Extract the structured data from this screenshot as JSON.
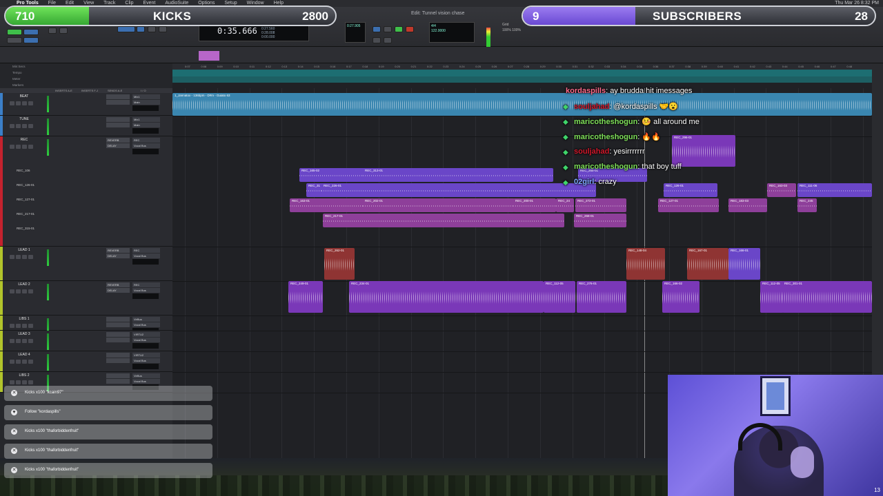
{
  "menubar": {
    "app": "Pro Tools",
    "items": [
      "File",
      "Edit",
      "View",
      "Track",
      "Clip",
      "Event",
      "AudioSuite",
      "Options",
      "Setup",
      "Window",
      "Help"
    ],
    "clock": "Thu Mar 26 8:32 PM"
  },
  "window_title": "Edit: Tunnel vision chase",
  "counter": {
    "main": "0:35.666",
    "start": "0:27.560",
    "end": "0:28.008",
    "length": "0:00.000",
    "cursor": "0:27.905",
    "nudge": "0:00.010"
  },
  "tempo": "122.0000",
  "meter_sig": "4/4",
  "grid": {
    "label": "Grid",
    "value": "100%",
    "swing": "100%"
  },
  "ruler": {
    "rows": [
      "Min:Secs",
      "Tempo",
      "Meter",
      "Markers"
    ],
    "default_label": "Default: 4/4",
    "ticks": [
      "0:07",
      "0:08",
      "0:09",
      "0:10",
      "0:11",
      "0:12",
      "0:13",
      "0:14",
      "0:15",
      "0:16",
      "0:17",
      "0:18",
      "0:19",
      "0:20",
      "0:21",
      "0:22",
      "0:23",
      "0:24",
      "0:25",
      "0:26",
      "0:27",
      "0:28",
      "0:29",
      "0:30",
      "0:31",
      "0:32",
      "0:33",
      "0:34",
      "0:35",
      "0:36",
      "0:37",
      "0:38",
      "0:39",
      "0:40",
      "0:41",
      "0:42",
      "0:43",
      "0:44",
      "0:45",
      "0:46",
      "0:47",
      "0:48"
    ]
  },
  "columns": {
    "inserts_ae": "INSERTS A-E",
    "inserts_fj": "INSERTS F-J",
    "sends_ae": "SENDS A-E",
    "io": "I / O"
  },
  "tracks": [
    {
      "name": "BEAT",
      "color": "#3b7fc8",
      "sends": [
        "",
        ""
      ],
      "io": [
        "Mix1",
        "Main"
      ]
    },
    {
      "name": "TUNE",
      "color": "#3b7fc8",
      "sends": [
        "",
        ""
      ],
      "io": [
        "Mix1",
        "Main"
      ]
    },
    {
      "name": "REC",
      "color": "#c4222e",
      "sends": [
        "REVERB",
        "DELAY"
      ],
      "io": [
        "REC",
        "Vocal Bus"
      ]
    },
    {
      "name": "LEAD 1",
      "color": "#b2c42b",
      "sends": [
        "REVERB",
        "DELAY"
      ],
      "io": [
        "REC",
        "Vocal Bus"
      ]
    },
    {
      "name": "LEAD 2",
      "color": "#b2c42b",
      "sends": [
        "REVERB",
        "DELAY"
      ],
      "io": [
        "REC",
        "Vocal Bus"
      ]
    },
    {
      "name": "LIBS 1",
      "color": "#b2c42b",
      "sends": [
        "",
        ""
      ],
      "io": [
        "VirBus",
        "Vocal Bus"
      ]
    },
    {
      "name": "LEAD 3",
      "color": "#b2c42b",
      "sends": [
        "",
        ""
      ],
      "io": [
        "VIRTU2",
        "Vocal Bus"
      ]
    },
    {
      "name": "LEAD 4",
      "color": "#b2c42b",
      "sends": [
        "",
        ""
      ],
      "io": [
        "VIRTU2",
        "Vocal Bus"
      ]
    },
    {
      "name": "LIBS 2",
      "color": "#b2c42b",
      "sends": [
        "",
        ""
      ],
      "io": [
        "VirBus",
        "Vocal Bus"
      ]
    }
  ],
  "sub_tracks": [
    "REC_106",
    "REC_126-01",
    "REC_127-01",
    "REC_217-01",
    "REC_315-01"
  ],
  "clips": {
    "beat": "1_Jannatox - 136bpm - D#m - Guiato 63",
    "rec_row1": [
      "REC_165-02",
      "REC_313-01",
      "REC_265-01",
      "REC_296-01"
    ],
    "rec_row2": [
      "REC_31",
      "REC_226-01",
      "REC_126-01",
      "REC_163-03",
      "REC_111-06"
    ],
    "rec_row3": [
      "REC_163-01",
      "REC_202-01",
      "REC_200-01",
      "REC_24",
      "REC_272-01",
      "REC_127-01",
      "REC_183-03",
      "REC_245"
    ],
    "rec_row4": [
      "REC_217-01",
      "REC_268-01"
    ],
    "lead1": [
      "REC_262-01",
      "REC_148-04",
      "REC_167-01",
      "REC_166-01"
    ],
    "lead2": [
      "REC_249-01",
      "REC_234-01",
      "REC_112-05",
      "REC_276-01",
      "REC_166-02",
      "REC_112-05",
      "REC_301-01"
    ],
    "gain": "0 dB"
  },
  "overlay": {
    "kicks": {
      "left": "710",
      "title": "KICKS",
      "right": "2800",
      "progress": 0.254
    },
    "subs": {
      "left": "9",
      "title": "SUBSCRIBERS",
      "right": "28",
      "progress": 0.32
    }
  },
  "chat": [
    {
      "user": "kordaspills",
      "color": "#ff6b8b",
      "msg": ": ay brudda hit imessages"
    },
    {
      "user": "souljahad",
      "color": "#d1182b",
      "msg": ": @kordaspills 🤝😮"
    },
    {
      "user": "maricotheshogun",
      "color": "#7fe05a",
      "msg": ": 🤒 all around me"
    },
    {
      "user": "maricotheshogun",
      "color": "#7fe05a",
      "msg": ": 🔥🔥"
    },
    {
      "user": "souljahad",
      "color": "#d1182b",
      "msg": ": yesirrrrrrr"
    },
    {
      "user": "maricotheshogun",
      "color": "#7fe05a",
      "msg": ": that boy tuff"
    },
    {
      "user": "02girl",
      "color": "#7fa8ff",
      "msg": ": crazy"
    }
  ],
  "alerts": [
    {
      "icon": "kicks",
      "text": "Kicks x100 \"kcain97\""
    },
    {
      "icon": "heart",
      "text": "Follow \"kordaspills\""
    },
    {
      "icon": "kicks",
      "text": "Kicks x100 \"thaforbiddenfruit\""
    },
    {
      "icon": "kicks",
      "text": "Kicks x100 \"thaforbiddenfruit\""
    },
    {
      "icon": "kicks",
      "text": "Kicks x100 \"thaforbiddenfruit\""
    }
  ],
  "webcam_badge": "13"
}
